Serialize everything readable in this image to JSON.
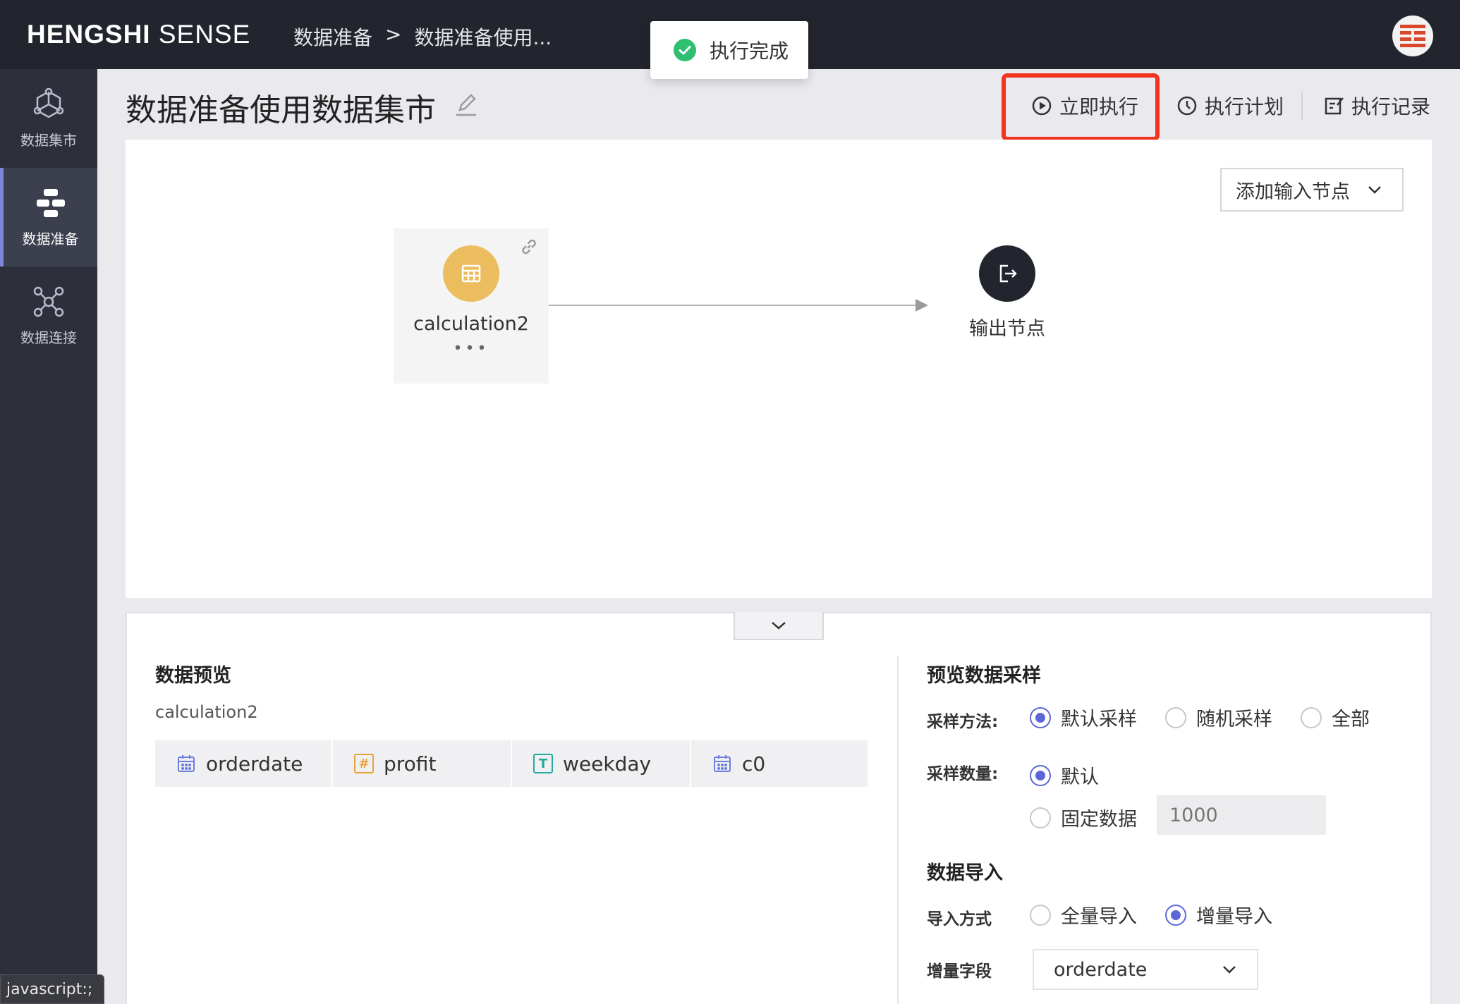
{
  "app": {
    "brand_bold": "HENGSHI",
    "brand_light": "SENSE"
  },
  "breadcrumb": {
    "items": [
      "数据准备",
      ">",
      "数据准备使用..."
    ]
  },
  "toast": {
    "text": "执行完成",
    "status_color": "#2fbf71"
  },
  "sidebar": {
    "items": [
      {
        "label": "数据集市",
        "icon": "hexagon-nodes-icon",
        "active": false
      },
      {
        "label": "数据准备",
        "icon": "flow-nodes-icon",
        "active": true
      },
      {
        "label": "数据连接",
        "icon": "network-icon",
        "active": false
      }
    ]
  },
  "header": {
    "title": "数据准备使用数据集市",
    "run_now": "立即执行",
    "schedule": "执行计划",
    "history": "执行记录",
    "highlight_color": "#f2331d"
  },
  "canvas": {
    "add_input_label": "添加输入节点",
    "input_node": {
      "label": "calculation2",
      "more": "•••"
    },
    "output_node": {
      "label": "输出节点"
    }
  },
  "preview": {
    "title": "数据预览",
    "dataset_name": "calculation2",
    "columns": [
      {
        "name": "orderdate",
        "type_icon": "calendar-icon"
      },
      {
        "name": "profit",
        "type_icon": "number-icon",
        "glyph": "#"
      },
      {
        "name": "weekday",
        "type_icon": "text-icon",
        "glyph": "T"
      },
      {
        "name": "c0",
        "type_icon": "calendar-icon"
      }
    ]
  },
  "sampling": {
    "title": "预览数据采样",
    "method_label": "采样方法:",
    "methods": [
      "默认采样",
      "随机采样",
      "全部"
    ],
    "method_selected": "默认采样",
    "count_label": "采样数量:",
    "count_default": "默认",
    "count_fixed": "固定数据",
    "count_selected": "默认",
    "count_placeholder": "1000"
  },
  "import": {
    "title": "数据导入",
    "mode_label": "导入方式",
    "modes": [
      "全量导入",
      "增量导入"
    ],
    "mode_selected": "增量导入",
    "field_label": "增量字段",
    "field_value": "orderdate"
  },
  "statusbar": {
    "text": "javascript:;"
  },
  "colors": {
    "accent": "#5b67d8",
    "topbar": "#23252e",
    "sidebar": "#2d303b",
    "node": "#ecbd5e"
  }
}
